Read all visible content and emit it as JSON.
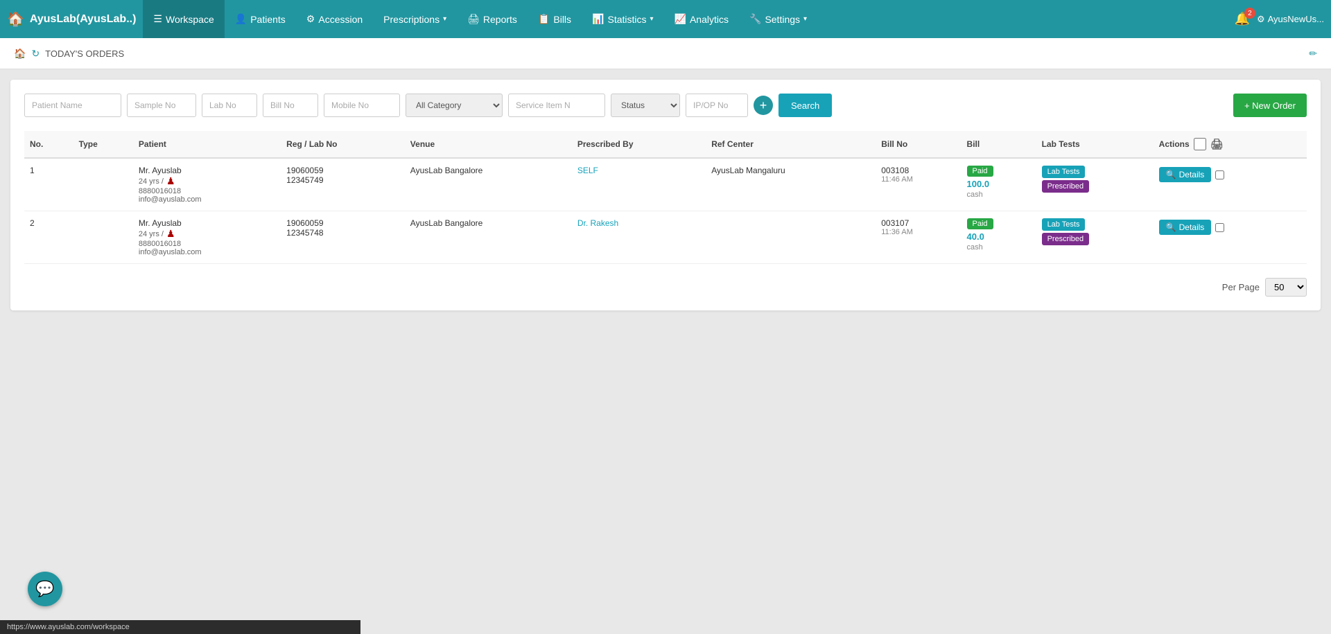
{
  "brand": {
    "icon": "🏠",
    "name": "AyusLab",
    "sub": "(AyusLab..)"
  },
  "navbar": {
    "items": [
      {
        "id": "workspace",
        "label": "Workspace",
        "icon": "☰",
        "active": true
      },
      {
        "id": "patients",
        "label": "Patients",
        "icon": "👤",
        "active": false
      },
      {
        "id": "accession",
        "label": "Accession",
        "icon": "⚙",
        "active": false
      },
      {
        "id": "prescriptions",
        "label": "Prescriptions",
        "icon": "",
        "active": false,
        "dropdown": true
      },
      {
        "id": "reports",
        "label": "Reports",
        "icon": "🖨",
        "active": false
      },
      {
        "id": "bills",
        "label": "Bills",
        "icon": "📋",
        "active": false
      },
      {
        "id": "statistics",
        "label": "Statistics",
        "icon": "📊",
        "active": false,
        "dropdown": true
      },
      {
        "id": "analytics",
        "label": "Analytics",
        "icon": "📈",
        "active": false
      },
      {
        "id": "settings",
        "label": "Settings",
        "icon": "🔧",
        "active": false,
        "dropdown": true
      }
    ],
    "notifications": {
      "count": "2"
    },
    "user": "AyusNewUs..."
  },
  "breadcrumb": {
    "title": "TODAY'S ORDERS"
  },
  "filters": {
    "patient_name": {
      "placeholder": "Patient Name",
      "value": ""
    },
    "sample_no": {
      "placeholder": "Sample No",
      "value": ""
    },
    "lab_no": {
      "placeholder": "Lab No",
      "value": ""
    },
    "bill_no": {
      "placeholder": "Bill No",
      "value": ""
    },
    "mobile_no": {
      "placeholder": "Mobile No",
      "value": ""
    },
    "category": {
      "value": "All Category",
      "options": [
        "All Category"
      ]
    },
    "service_item": {
      "placeholder": "Service Item N",
      "value": ""
    },
    "status": {
      "value": "Status",
      "options": [
        "Status"
      ]
    },
    "ip_op": {
      "placeholder": "IP/OP No",
      "value": ""
    },
    "search_label": "Search",
    "new_order_label": "+ New Order"
  },
  "table": {
    "columns": [
      "No.",
      "Type",
      "Patient",
      "Reg / Lab No",
      "Venue",
      "Prescribed By",
      "Ref Center",
      "Bill No",
      "Bill",
      "Lab Tests",
      "Actions"
    ],
    "rows": [
      {
        "no": "1",
        "type": "",
        "patient_name": "Mr. Ayuslab",
        "patient_age": "24 yrs /",
        "patient_phone": "8880016018",
        "patient_email": "info@ayuslab.com",
        "reg_no": "19060059",
        "lab_no": "12345749",
        "venue": "AyusLab Bangalore",
        "prescribed_by": "SELF",
        "ref_center": "AyusLab Mangaluru",
        "bill_no": "003108",
        "bill_time": "11:46 AM",
        "bill_status": "Paid",
        "bill_amount": "100.0",
        "bill_method": "cash",
        "lab_tests_label": "Lab Tests",
        "prescribed_label": "Prescribed",
        "details_label": "Details"
      },
      {
        "no": "2",
        "type": "",
        "patient_name": "Mr. Ayuslab",
        "patient_age": "24 yrs /",
        "patient_phone": "8880016018",
        "patient_email": "info@ayuslab.com",
        "reg_no": "19060059",
        "lab_no": "12345748",
        "venue": "AyusLab Bangalore",
        "prescribed_by": "Dr. Rakesh",
        "ref_center": "",
        "bill_no": "003107",
        "bill_time": "11:36 AM",
        "bill_status": "Paid",
        "bill_amount": "40.0",
        "bill_method": "cash",
        "lab_tests_label": "Lab Tests",
        "prescribed_label": "Prescribed",
        "details_label": "Details"
      }
    ]
  },
  "pagination": {
    "per_page_label": "Per Page",
    "per_page_value": "50"
  },
  "status_bar": {
    "url": "https://www.ayuslab.com/workspace"
  },
  "chat_icon": "💬"
}
